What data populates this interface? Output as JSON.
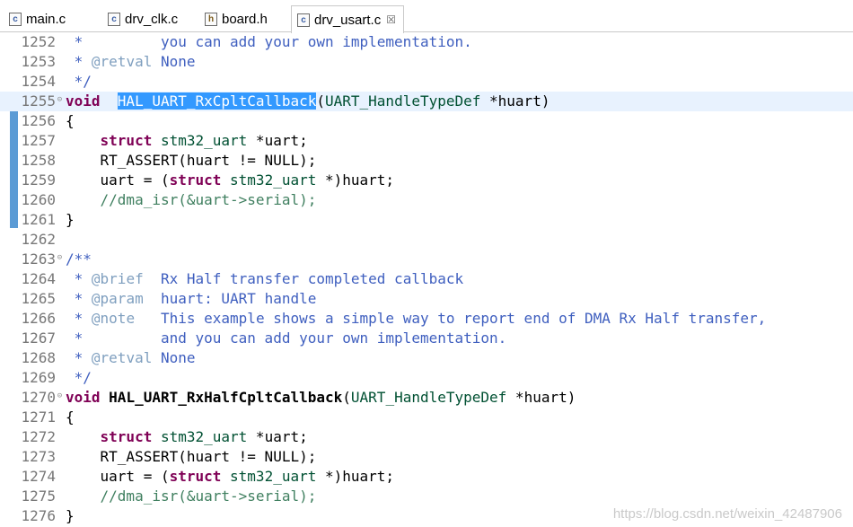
{
  "tabs": [
    {
      "label": "main.c",
      "icon": "c-file-icon"
    },
    {
      "label": "drv_clk.c",
      "icon": "c-file-icon"
    },
    {
      "label": "board.h",
      "icon": "h-file-icon"
    },
    {
      "label": "drv_usart.c",
      "icon": "c-file-icon",
      "close": "☒"
    }
  ],
  "colors": {
    "keyword": "#7f0055",
    "comment": "#3f5fbf",
    "line_comment": "#3f7f5f",
    "selection": "#3399ff"
  },
  "lines": [
    {
      "n": "1252",
      "parts": [
        [
          "cm",
          " *         you can add your own implementation."
        ]
      ]
    },
    {
      "n": "1253",
      "parts": [
        [
          "cm",
          " * "
        ],
        [
          "tg",
          "@retval"
        ],
        [
          "cm",
          " None"
        ]
      ]
    },
    {
      "n": "1254",
      "parts": [
        [
          "cm",
          " */"
        ]
      ]
    },
    {
      "n": "1255",
      "fold": true,
      "hl": true,
      "parts": [
        [
          "kw",
          "void"
        ],
        [
          "",
          "  "
        ],
        [
          "sel",
          "HAL_UART_RxCpltCallback"
        ],
        [
          "",
          "("
        ],
        [
          "ty",
          "UART_HandleTypeDef"
        ],
        [
          "",
          " *huart)"
        ]
      ]
    },
    {
      "n": "1256",
      "parts": [
        [
          "",
          "{"
        ]
      ]
    },
    {
      "n": "1257",
      "parts": [
        [
          "",
          "    "
        ],
        [
          "kw",
          "struct"
        ],
        [
          "",
          " "
        ],
        [
          "ty",
          "stm32_uart"
        ],
        [
          "",
          " *uart;"
        ]
      ]
    },
    {
      "n": "1258",
      "parts": [
        [
          "",
          "    RT_ASSERT(huart != NULL);"
        ]
      ]
    },
    {
      "n": "1259",
      "parts": [
        [
          "",
          "    uart = ("
        ],
        [
          "kw",
          "struct"
        ],
        [
          "",
          " "
        ],
        [
          "ty",
          "stm32_uart"
        ],
        [
          "",
          " *)huart;"
        ]
      ]
    },
    {
      "n": "1260",
      "parts": [
        [
          "cc",
          "    //dma_isr(&uart->serial);"
        ]
      ]
    },
    {
      "n": "1261",
      "parts": [
        [
          "",
          "}"
        ]
      ]
    },
    {
      "n": "1262",
      "parts": []
    },
    {
      "n": "1263",
      "fold": true,
      "parts": [
        [
          "cm",
          "/**"
        ]
      ]
    },
    {
      "n": "1264",
      "parts": [
        [
          "cm",
          " * "
        ],
        [
          "tg",
          "@brief"
        ],
        [
          "cm",
          "  Rx Half transfer completed callback"
        ]
      ]
    },
    {
      "n": "1265",
      "parts": [
        [
          "cm",
          " * "
        ],
        [
          "tg",
          "@param"
        ],
        [
          "cm",
          "  huart: UART handle"
        ]
      ]
    },
    {
      "n": "1266",
      "parts": [
        [
          "cm",
          " * "
        ],
        [
          "tg",
          "@note"
        ],
        [
          "cm",
          "   This example shows a simple way to report end of DMA Rx Half transfer,"
        ]
      ]
    },
    {
      "n": "1267",
      "parts": [
        [
          "cm",
          " *         and you can add your own implementation."
        ]
      ]
    },
    {
      "n": "1268",
      "parts": [
        [
          "cm",
          " * "
        ],
        [
          "tg",
          "@retval"
        ],
        [
          "cm",
          " None"
        ]
      ]
    },
    {
      "n": "1269",
      "parts": [
        [
          "cm",
          " */"
        ]
      ]
    },
    {
      "n": "1270",
      "fold": true,
      "parts": [
        [
          "kw",
          "void"
        ],
        [
          "",
          " "
        ],
        [
          "fn",
          "HAL_UART_RxHalfCpltCallback"
        ],
        [
          "",
          "("
        ],
        [
          "ty",
          "UART_HandleTypeDef"
        ],
        [
          "",
          " *huart)"
        ]
      ]
    },
    {
      "n": "1271",
      "parts": [
        [
          "",
          "{"
        ]
      ]
    },
    {
      "n": "1272",
      "parts": [
        [
          "",
          "    "
        ],
        [
          "kw",
          "struct"
        ],
        [
          "",
          " "
        ],
        [
          "ty",
          "stm32_uart"
        ],
        [
          "",
          " *uart;"
        ]
      ]
    },
    {
      "n": "1273",
      "parts": [
        [
          "",
          "    RT_ASSERT(huart != NULL);"
        ]
      ]
    },
    {
      "n": "1274",
      "parts": [
        [
          "",
          "    uart = ("
        ],
        [
          "kw",
          "struct"
        ],
        [
          "",
          " "
        ],
        [
          "ty",
          "stm32_uart"
        ],
        [
          "",
          " *)huart;"
        ]
      ]
    },
    {
      "n": "1275",
      "parts": [
        [
          "cc",
          "    //dma_isr(&uart->serial);"
        ]
      ]
    },
    {
      "n": "1276",
      "parts": [
        [
          "",
          "}"
        ]
      ]
    }
  ],
  "watermark": "https://blog.csdn.net/weixin_42487906"
}
